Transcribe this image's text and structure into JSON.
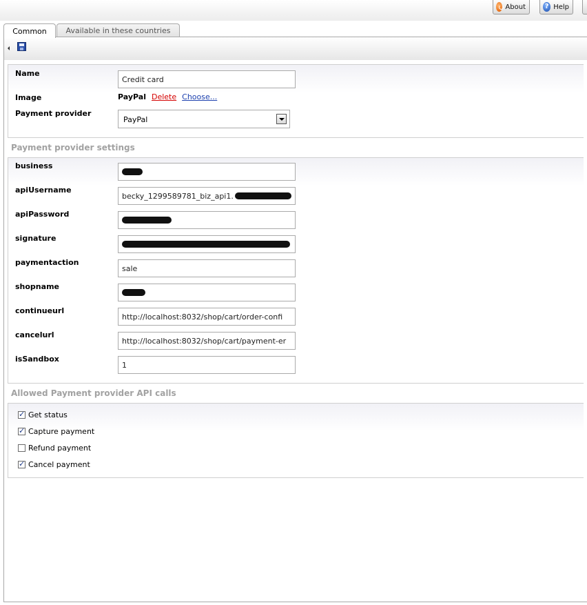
{
  "header": {
    "about_label": "About",
    "help_label": "Help"
  },
  "tabs": [
    {
      "label": "Common",
      "active": true
    },
    {
      "label": "Available in these countries",
      "active": false
    }
  ],
  "general": {
    "name_label": "Name",
    "name_value": "Credit card",
    "image_label": "Image",
    "image_value": "PayPal",
    "delete_link": "Delete",
    "choose_link": "Choose...",
    "provider_label": "Payment provider",
    "provider_value": "PayPal"
  },
  "provider_settings": {
    "title": "Payment provider settings",
    "fields": [
      {
        "label": "business",
        "value": ""
      },
      {
        "label": "apiUsername",
        "value": "becky_1299589781_biz_api1."
      },
      {
        "label": "apiPassword",
        "value": ""
      },
      {
        "label": "signature",
        "value": ""
      },
      {
        "label": "paymentaction",
        "value": "sale"
      },
      {
        "label": "shopname",
        "value": ""
      },
      {
        "label": "continueurl",
        "value": "http://localhost:8032/shop/cart/order-confi"
      },
      {
        "label": "cancelurl",
        "value": "http://localhost:8032/shop/cart/payment-er"
      },
      {
        "label": "isSandbox",
        "value": "1"
      }
    ]
  },
  "api_calls": {
    "title": "Allowed Payment provider API calls",
    "items": [
      {
        "label": "Get status",
        "checked": true
      },
      {
        "label": "Capture payment",
        "checked": true
      },
      {
        "label": "Refund payment",
        "checked": false
      },
      {
        "label": "Cancel payment",
        "checked": true
      }
    ]
  }
}
